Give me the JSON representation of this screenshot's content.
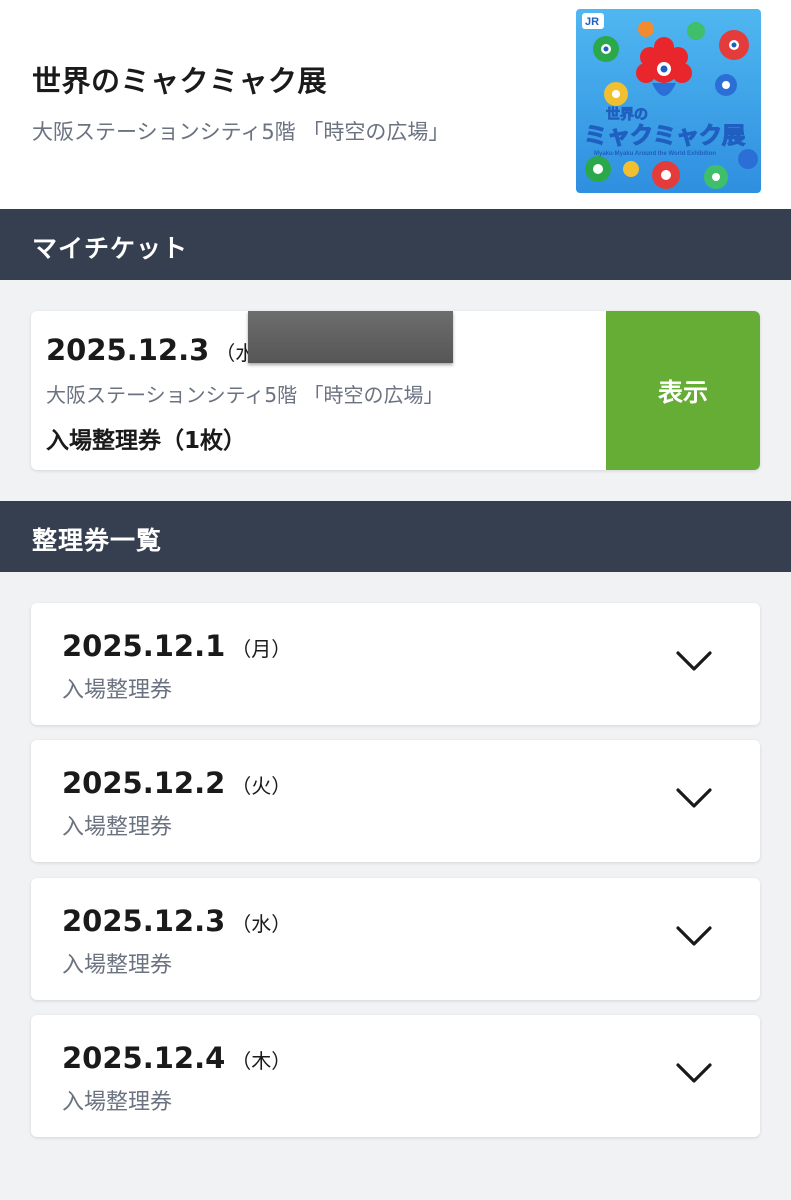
{
  "event": {
    "title": "世界のミャクミャク展",
    "venue": "大阪ステーションシティ5階 「時空の広場」",
    "poster": {
      "badge": "JR",
      "logo_top": "世界の",
      "logo_main": "ミャクミャク展",
      "logo_sub": "Myaku-Myaku Around the World Exhibition"
    }
  },
  "my_tickets": {
    "heading": "マイチケット",
    "ticket": {
      "date": "2025.12.3",
      "weekday": "（水）",
      "venue": "大阪ステーションシティ5階 「時空の広場」",
      "type": "入場整理券（1枚）",
      "show_label": "表示"
    }
  },
  "ticket_list": {
    "heading": "整理券一覧",
    "items": [
      {
        "date": "2025.12.1",
        "weekday": "（月）",
        "type": "入場整理券"
      },
      {
        "date": "2025.12.2",
        "weekday": "（火）",
        "type": "入場整理券"
      },
      {
        "date": "2025.12.3",
        "weekday": "（水）",
        "type": "入場整理券"
      },
      {
        "date": "2025.12.4",
        "weekday": "（木）",
        "type": "入場整理券"
      }
    ]
  },
  "colors": {
    "section_bar": "#353f50",
    "show_button": "#66ad35",
    "background": "#f1f2f4"
  },
  "icons": {
    "expand": "chevron-down-icon"
  }
}
